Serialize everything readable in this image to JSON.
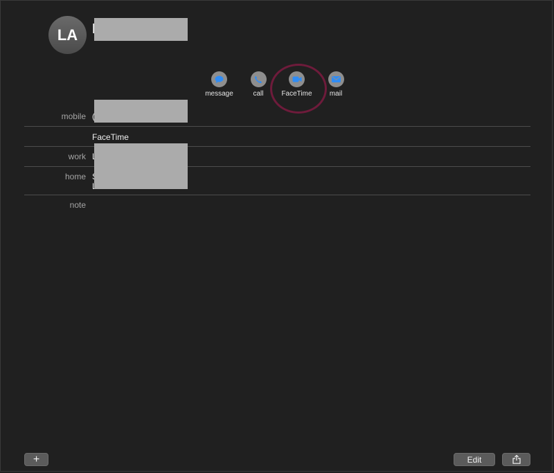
{
  "contact": {
    "initials": "LA",
    "name_visible": "L"
  },
  "actions": [
    {
      "label": "message",
      "icon": "message-icon"
    },
    {
      "label": "call",
      "icon": "phone-icon"
    },
    {
      "label": "FaceTime",
      "icon": "video-icon"
    },
    {
      "label": "mail",
      "icon": "mail-icon"
    }
  ],
  "fields": {
    "mobile": {
      "label": "mobile",
      "value_visible": "("
    },
    "facetime": {
      "value": "FaceTime"
    },
    "work": {
      "label": "work",
      "value_visible": "L"
    },
    "home": {
      "label": "home",
      "line1_visible": "S",
      "line2_visible": "L"
    },
    "note": {
      "label": "note"
    }
  },
  "footer": {
    "add_label": "+",
    "edit_label": "Edit"
  },
  "colors": {
    "background": "#202020",
    "accent": "#2f8cf5",
    "highlight_ring": "#6e1b3b",
    "redaction": "#ababab"
  }
}
